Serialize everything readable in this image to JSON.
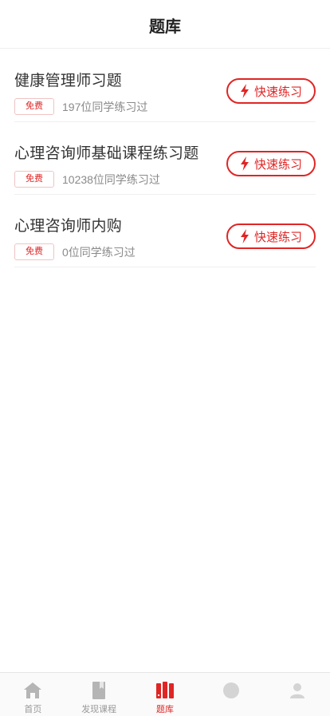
{
  "header": {
    "title": "题库"
  },
  "items": [
    {
      "name": "健康管理师习题",
      "badge": "免费",
      "count": "197位同学练习过",
      "button": "快速练习"
    },
    {
      "name": "心理咨询师基础课程练习题",
      "badge": "免费",
      "count": "10238位同学练习过",
      "button": "快速练习"
    },
    {
      "name": "心理咨询师内购",
      "badge": "免费",
      "count": "0位同学练习过",
      "button": "快速练习"
    }
  ],
  "tabbar": {
    "tabs": [
      {
        "label": "首页",
        "icon": "home-icon"
      },
      {
        "label": "发现课程",
        "icon": "book-icon"
      },
      {
        "label": "题库",
        "icon": "question-bank-icon",
        "active": true
      },
      {
        "label": "",
        "icon": "study-icon"
      },
      {
        "label": "",
        "icon": "user-icon"
      }
    ]
  },
  "colors": {
    "accent": "#e02525",
    "muted": "#999999"
  }
}
